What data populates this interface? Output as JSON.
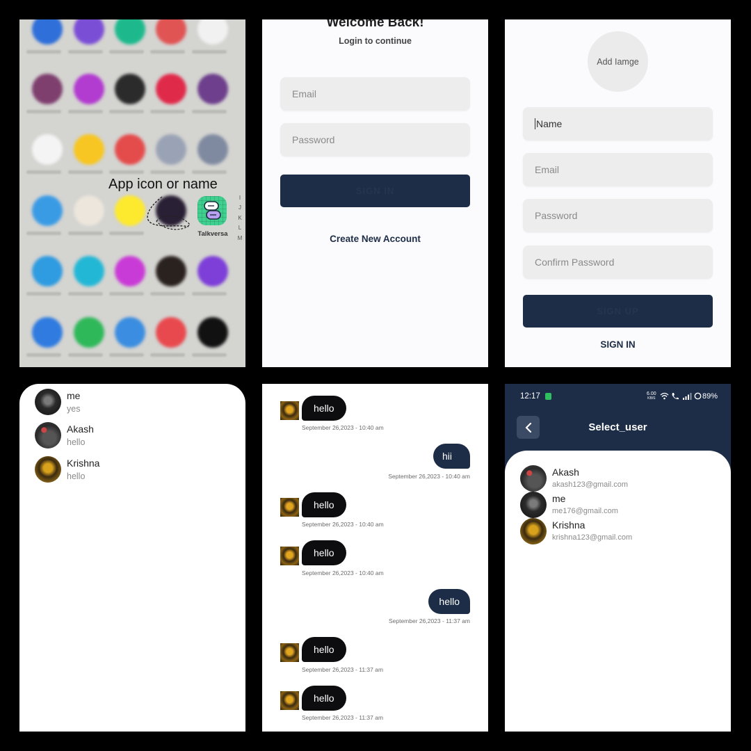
{
  "launcher": {
    "hint": "App icon or name",
    "highlighted_app": "Talkversa",
    "index_letters": [
      "I",
      "J",
      "K",
      "L",
      "M"
    ],
    "app_colors": [
      [
        "#2f6fd9",
        "#7b4ed6",
        "#1db98c",
        "#e05454",
        "#f1f1f1"
      ],
      [
        "#7e3f6e",
        "#b23bd0",
        "#2b2b2b",
        "#e02a4a",
        "#6d3f8c"
      ],
      [
        "#f4f4f4",
        "#f7c622",
        "#e44c4c",
        "#9aa3b5",
        "#7f8aa0"
      ],
      [
        "#3a9be5",
        "#ece6dc",
        "#fde92e",
        "#2a2035",
        ""
      ],
      [
        "#2f9be0",
        "#23b7d6",
        "#c93bd6",
        "#2a221e",
        "#7d3fd8"
      ],
      [
        "#2f7be0",
        "#2fb85a",
        "#3a8de0",
        "#e8494e",
        "#111111"
      ]
    ]
  },
  "login": {
    "title": "Welcome Back!",
    "subtitle": "Login to continue",
    "email_placeholder": "Email",
    "password_placeholder": "Password",
    "button_label": "SIGN IN",
    "create_account": "Create New Account"
  },
  "signup": {
    "add_image": "Add Iamge",
    "name_placeholder": "Name",
    "email_placeholder": "Email",
    "password_placeholder": "Password",
    "confirm_placeholder": "Confirm Password",
    "button_label": "SIGN UP",
    "sign_in": "SIGN IN"
  },
  "chats": [
    {
      "name": "me",
      "last": "yes"
    },
    {
      "name": "Akash",
      "last": "hello"
    },
    {
      "name": "Krishna",
      "last": "hello"
    }
  ],
  "messages": [
    {
      "dir": "in",
      "text": "hello",
      "time": "September 26,2023 - 10:40 am"
    },
    {
      "dir": "out",
      "text": "hii",
      "time": "September 26,2023 - 10:40 am"
    },
    {
      "dir": "in",
      "text": "hello",
      "time": "September 26,2023 - 10:40 am"
    },
    {
      "dir": "in",
      "text": "hello",
      "time": "September 26,2023 - 10:40 am"
    },
    {
      "dir": "out",
      "text": "hello",
      "time": "September 26,2023 - 11:37 am"
    },
    {
      "dir": "in",
      "text": "hello",
      "time": "September 26,2023 - 11:37 am"
    },
    {
      "dir": "in",
      "text": "hello",
      "time": "September 26,2023 - 11:37 am"
    }
  ],
  "select_user": {
    "status_time": "12:17",
    "status_speed": "6.00",
    "status_speed_unit": "KB/S",
    "battery": "89%",
    "title": "Select_user",
    "users": [
      {
        "name": "Akash",
        "email": "akash123@gmail.com"
      },
      {
        "name": "me",
        "email": "me176@gmail.com"
      },
      {
        "name": "Krishna",
        "email": "krishna123@gmail.com"
      }
    ]
  },
  "colors": {
    "primary": "#1e2d47",
    "bubble_in": "#0d0d0f",
    "field": "#ededed",
    "talkversa_icon": "#3fcf8e"
  }
}
